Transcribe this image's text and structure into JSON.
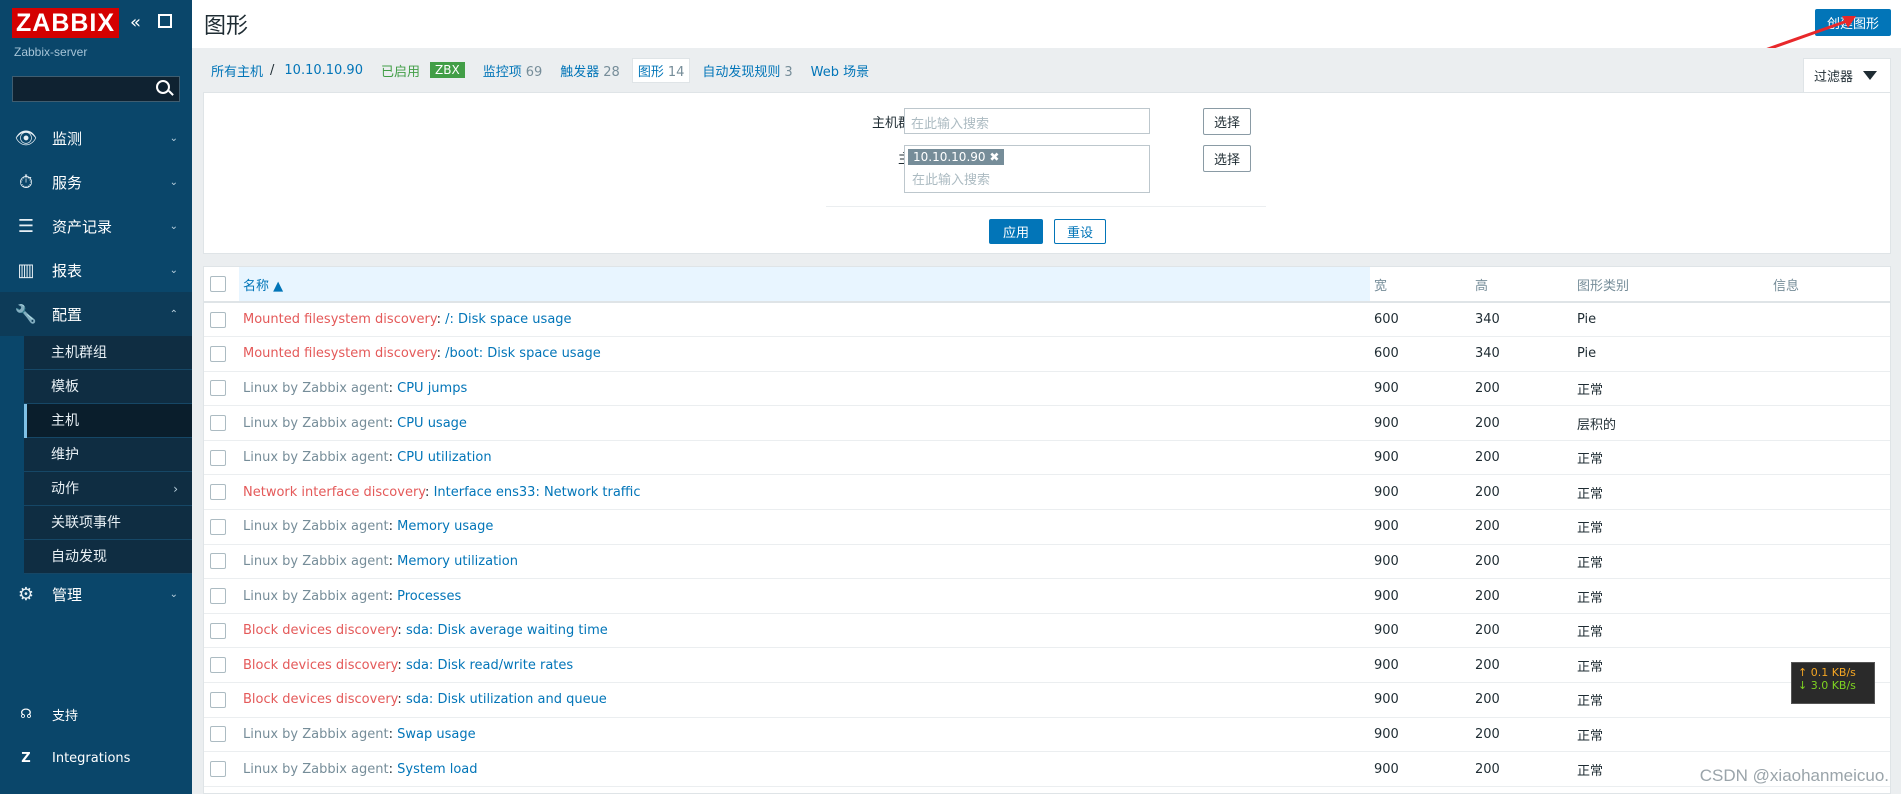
{
  "sidebar": {
    "logo": "ZABBIX",
    "server": "Zabbix-server",
    "search_placeholder": "",
    "menu": [
      {
        "label": "监测"
      },
      {
        "label": "服务"
      },
      {
        "label": "资产记录"
      },
      {
        "label": "报表"
      },
      {
        "label": "配置"
      },
      {
        "label": "管理"
      }
    ],
    "config_sub": [
      "主机群组",
      "模板",
      "主机",
      "维护",
      "动作",
      "关联项事件",
      "自动发现"
    ],
    "footer": [
      {
        "label": "支持"
      },
      {
        "label": "Integrations"
      }
    ]
  },
  "header": {
    "title": "图形",
    "create_button": "创建图形"
  },
  "breadcrumb": {
    "all_hosts": "所有主机",
    "separator": "/",
    "host": "10.10.10.90",
    "enabled": "已启用",
    "zbx": "ZBX",
    "items_label": "监控项",
    "items_count": "69",
    "triggers_label": "触发器",
    "triggers_count": "28",
    "graphs_label": "图形",
    "graphs_count": "14",
    "discovery_label": "自动发现规则",
    "discovery_count": "3",
    "web_label": "Web 场景",
    "filter_tab": "过滤器"
  },
  "filter": {
    "host_group_label": "主机群组",
    "host_group_placeholder": "在此输入搜索",
    "host_label": "主机",
    "host_chip": "10.10.10.90",
    "host_placeholder": "在此输入搜索",
    "select_label": "选择",
    "apply_label": "应用",
    "reset_label": "重设"
  },
  "table": {
    "headers": {
      "name": "名称 ▲",
      "width": "宽",
      "height": "高",
      "type": "图形类别",
      "info": "信息"
    },
    "rows": [
      {
        "prefix": "Mounted filesystem discovery",
        "prefix_style": "red",
        "name": "/: Disk space usage",
        "width": "600",
        "height": "340",
        "type": "Pie"
      },
      {
        "prefix": "Mounted filesystem discovery",
        "prefix_style": "red",
        "name": "/boot: Disk space usage",
        "width": "600",
        "height": "340",
        "type": "Pie"
      },
      {
        "prefix": "Linux by Zabbix agent",
        "prefix_style": "gray",
        "name": "CPU jumps",
        "width": "900",
        "height": "200",
        "type": "正常"
      },
      {
        "prefix": "Linux by Zabbix agent",
        "prefix_style": "gray",
        "name": "CPU usage",
        "width": "900",
        "height": "200",
        "type": "层积的"
      },
      {
        "prefix": "Linux by Zabbix agent",
        "prefix_style": "gray",
        "name": "CPU utilization",
        "width": "900",
        "height": "200",
        "type": "正常"
      },
      {
        "prefix": "Network interface discovery",
        "prefix_style": "red",
        "name": "Interface ens33: Network traffic",
        "width": "900",
        "height": "200",
        "type": "正常"
      },
      {
        "prefix": "Linux by Zabbix agent",
        "prefix_style": "gray",
        "name": "Memory usage",
        "width": "900",
        "height": "200",
        "type": "正常"
      },
      {
        "prefix": "Linux by Zabbix agent",
        "prefix_style": "gray",
        "name": "Memory utilization",
        "width": "900",
        "height": "200",
        "type": "正常"
      },
      {
        "prefix": "Linux by Zabbix agent",
        "prefix_style": "gray",
        "name": "Processes",
        "width": "900",
        "height": "200",
        "type": "正常"
      },
      {
        "prefix": "Block devices discovery",
        "prefix_style": "red",
        "name": "sda: Disk average waiting time",
        "width": "900",
        "height": "200",
        "type": "正常"
      },
      {
        "prefix": "Block devices discovery",
        "prefix_style": "red",
        "name": "sda: Disk read/write rates",
        "width": "900",
        "height": "200",
        "type": "正常"
      },
      {
        "prefix": "Block devices discovery",
        "prefix_style": "red",
        "name": "sda: Disk utilization and queue",
        "width": "900",
        "height": "200",
        "type": "正常"
      },
      {
        "prefix": "Linux by Zabbix agent",
        "prefix_style": "gray",
        "name": "Swap usage",
        "width": "900",
        "height": "200",
        "type": "正常"
      },
      {
        "prefix": "Linux by Zabbix agent",
        "prefix_style": "gray",
        "name": "System load",
        "width": "900",
        "height": "200",
        "type": "正常"
      }
    ]
  },
  "net_widget": {
    "up": "↑ 0.1 KB/s",
    "down": "↓ 3.0 KB/s"
  },
  "watermark": "CSDN @xiaohanmeicuo.",
  "colors": {
    "sidebar": "#0a466a",
    "accent": "#0275b8",
    "red": "#e45959",
    "logo": "#d40000"
  }
}
